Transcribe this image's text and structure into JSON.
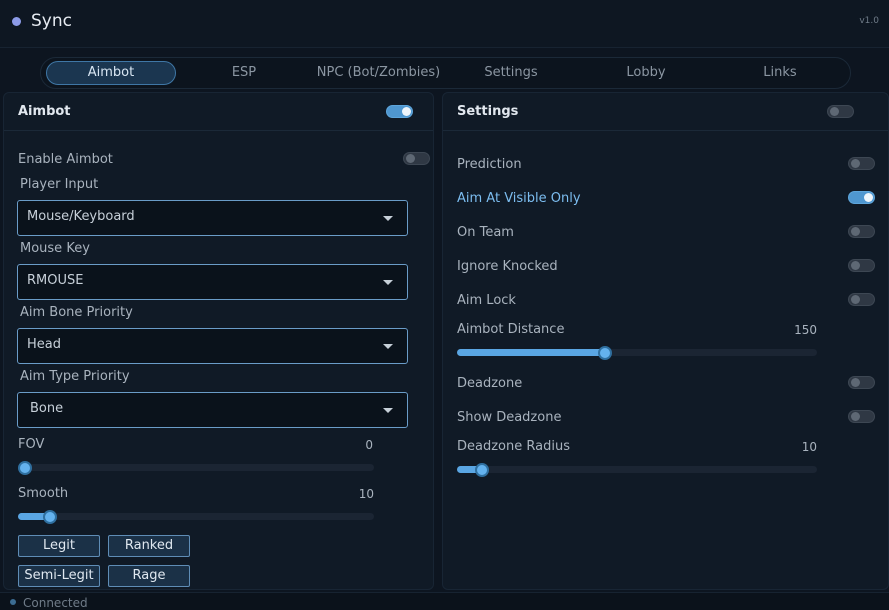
{
  "app": {
    "title": "Sync",
    "version": "v1.0"
  },
  "tabs": [
    {
      "label": "Aimbot",
      "active": true
    },
    {
      "label": "ESP"
    },
    {
      "label": "NPC (Bot/Zombies)"
    },
    {
      "label": "Settings"
    },
    {
      "label": "Lobby"
    },
    {
      "label": "Links"
    }
  ],
  "left_panel": {
    "title": "Aimbot",
    "header_toggle_on": true,
    "enable_aimbot": {
      "label": "Enable Aimbot",
      "on": false
    },
    "player_input": {
      "label": "Player Input",
      "value": "Mouse/Keyboard"
    },
    "mouse_key": {
      "label": "Mouse Key",
      "value": "RMOUSE"
    },
    "aim_bone_priority": {
      "label": "Aim Bone Priority",
      "value": "Head"
    },
    "aim_type_priority": {
      "label": "Aim Type Priority",
      "value": "Bone"
    },
    "fov": {
      "label": "FOV",
      "value": "0",
      "fraction": 0.0
    },
    "smooth": {
      "label": "Smooth",
      "value": "10",
      "fraction": 0.09
    },
    "presets": {
      "legit": "Legit",
      "ranked": "Ranked",
      "semi_legit": "Semi-Legit",
      "rage": "Rage"
    }
  },
  "right_panel": {
    "title": "Settings",
    "header_toggle_on": false,
    "prediction": {
      "label": "Prediction",
      "on": false
    },
    "aim_visible_only": {
      "label": "Aim At Visible Only",
      "on": true
    },
    "on_team": {
      "label": "On Team",
      "on": false
    },
    "ignore_knocked": {
      "label": "Ignore Knocked",
      "on": false
    },
    "aim_lock": {
      "label": "Aim Lock",
      "on": false
    },
    "aimbot_distance": {
      "label": "Aimbot Distance",
      "value": "150",
      "fraction": 0.41
    },
    "deadzone": {
      "label": "Deadzone",
      "on": false
    },
    "show_deadzone": {
      "label": "Show Deadzone",
      "on": false
    },
    "deadzone_radius": {
      "label": "Deadzone Radius",
      "value": "10",
      "fraction": 0.07
    }
  },
  "status": {
    "text": "Connected"
  },
  "colors": {
    "accent": "#5aa6e3",
    "background": "#0d1520",
    "panel": "#101a26"
  }
}
